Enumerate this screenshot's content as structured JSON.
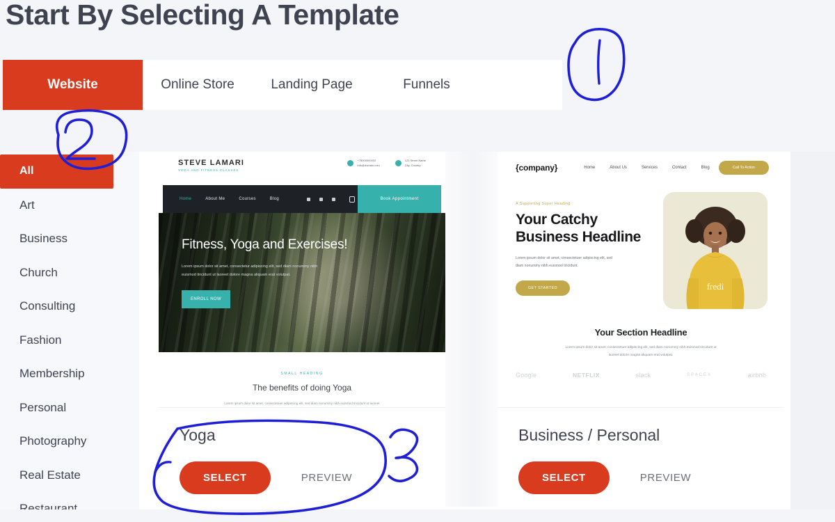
{
  "page": {
    "title": "Start By Selecting A Template",
    "background_color": "#f4f5f9",
    "accent_color": "#d93b1e"
  },
  "tabs": [
    {
      "label": "Website",
      "active": true
    },
    {
      "label": "Online Store",
      "active": false
    },
    {
      "label": "Landing Page",
      "active": false
    },
    {
      "label": "Funnels",
      "active": false
    }
  ],
  "sidebar": {
    "categories": [
      {
        "label": "All",
        "active": true
      },
      {
        "label": "Art",
        "active": false
      },
      {
        "label": "Business",
        "active": false
      },
      {
        "label": "Church",
        "active": false
      },
      {
        "label": "Consulting",
        "active": false
      },
      {
        "label": "Fashion",
        "active": false
      },
      {
        "label": "Membership",
        "active": false
      },
      {
        "label": "Personal",
        "active": false
      },
      {
        "label": "Photography",
        "active": false
      },
      {
        "label": "Real Estate",
        "active": false
      },
      {
        "label": "Restaurant",
        "active": false
      }
    ]
  },
  "templates": [
    {
      "name": "Yoga",
      "select_label": "SELECT",
      "preview_label": "PREVIEW",
      "thumbnail": {
        "logo": "STEVE LAMARI",
        "logo_sub": "YOGA AND FITNESS CLASSES",
        "phone": "+78000000002",
        "email": "info@domain.com",
        "address_line1": "123 Street Name",
        "address_line2": "City, Country",
        "nav": [
          "Home",
          "About Me",
          "Courses",
          "Blog"
        ],
        "nav_cta": "Book Appointment",
        "hero_heading": "Fitness, Yoga and Exercises!",
        "hero_paragraph": "Lorem ipsum dolor sit amet, consectetur adipiscing elit, sed diam nonummy nibh euismod tincidunt ut laoreet dolore magna aliquam erat volutpat.",
        "hero_button": "ENROLL NOW",
        "section_kicker": "SMALL HEADING",
        "section_heading": "The benefits of doing Yoga",
        "section_paragraph": "Lorem ipsum dolor sit amet, consectetuer adipiscing elit, sed diam nonummy nibh euismod tincidunt ut laoreet dolore magna aliquam erat volutpat."
      }
    },
    {
      "name": "Business / Personal",
      "select_label": "SELECT",
      "preview_label": "PREVIEW",
      "thumbnail": {
        "logo": "{company}",
        "nav": [
          "Home",
          "About Us",
          "Services",
          "Contact",
          "Blog"
        ],
        "nav_cta": "Call To Action",
        "hero_kicker": "A Supporting Super Heading",
        "hero_heading": "Your Catchy Business Headline",
        "hero_paragraph": "Lorem ipsum dolor sit amet, consectetuer adipiscing elit, sed diam nonummy nibh euismod tincidunt.",
        "hero_button": "GET STARTED",
        "shirt_text": "fredi",
        "section_heading": "Your Section Headline",
        "section_paragraph": "Lorem ipsum dolor sit amet, consectetuer adipiscing elit, sed diam nonummy nibh euismod tincidunt ut laoreet dolore magna aliquam erat volutpat.",
        "brand_logos": [
          "Google",
          "NETFLIX",
          "slack",
          "SPACEX",
          "airbnb"
        ]
      }
    }
  ],
  "annotations": {
    "color": "#1f1fd6",
    "marks": [
      {
        "label": "1",
        "target": "tab-bar-region"
      },
      {
        "label": "2",
        "target": "sidebar-all-category"
      },
      {
        "label": "3",
        "target": "yoga-select-preview-buttons"
      }
    ]
  }
}
